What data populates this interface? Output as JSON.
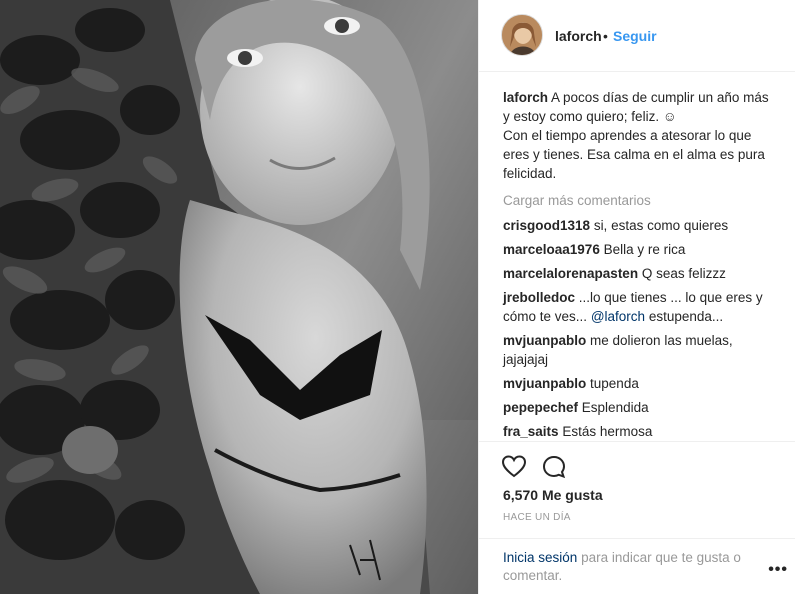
{
  "header": {
    "username": "laforch",
    "separator": "•",
    "follow_label": "Seguir"
  },
  "caption": {
    "username": "laforch",
    "line1": "A pocos días de cumplir un año más y estoy como quiero; feliz. ☺",
    "line2": "Con el tiempo aprendes a atesorar lo que eres y tienes. Esa calma en el alma es pura felicidad."
  },
  "load_more_label": "Cargar más comentarios",
  "comments": [
    {
      "user": "crisgood1318",
      "text": "si, estas como quieres"
    },
    {
      "user": "marceloaa1976",
      "text": "Bella y re rica"
    },
    {
      "user": "marcelalorenapasten",
      "text": "Q seas felizzz"
    },
    {
      "user": "jrebolledoc",
      "text": "...lo que tienes ... lo que eres y cómo te ves...",
      "mention": "@laforch",
      "text_after": "estupenda..."
    },
    {
      "user": "mvjuanpablo",
      "text": "me dolieron las muelas, jajajajaj"
    },
    {
      "user": "mvjuanpablo",
      "text": "tupenda"
    },
    {
      "user": "pepepechef",
      "text": "Esplendida"
    },
    {
      "user": "fra_saits",
      "text": "Estás hermosa"
    }
  ],
  "actions": {
    "like_icon": "heart-icon",
    "comment_icon": "comment-icon",
    "likes_count": "6,570",
    "likes_label": "Me gusta",
    "timestamp": "Hace un día"
  },
  "login": {
    "link": "Inicia sesión",
    "text": "para indicar que te gusta o comentar."
  },
  "more_options": "•••"
}
